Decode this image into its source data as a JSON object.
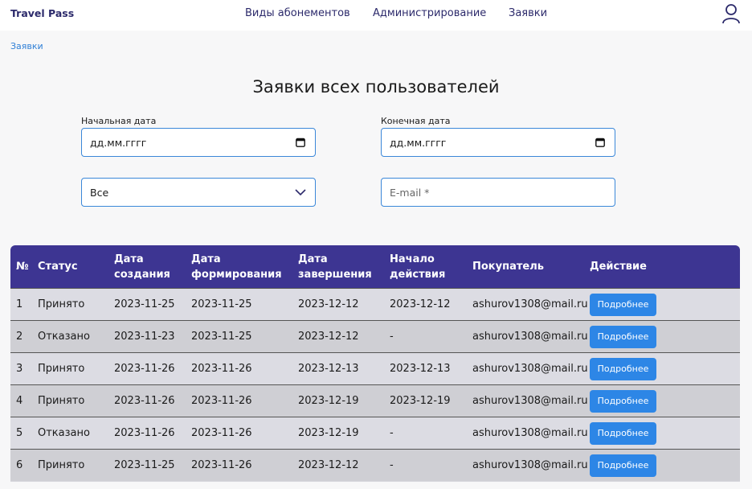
{
  "navbar": {
    "brand": "Travel Pass",
    "links": [
      "Виды абонементов",
      "Администрирование",
      "Заявки"
    ]
  },
  "breadcrumb": "Заявки",
  "page_title": "Заявки всех пользователей",
  "filters": {
    "start_date_label": "Начальная дата",
    "start_date_value": "дд.мм.гггг",
    "end_date_label": "Конечная дата",
    "end_date_value": "дд.мм.гггг",
    "status_select_value": "Все",
    "email_placeholder": "E-mail *"
  },
  "table": {
    "headers": {
      "num": "№",
      "status": "Статус",
      "created_1": "Дата",
      "created_2": "создания",
      "formed_1": "Дата",
      "formed_2": "формирования",
      "completed_1": "Дата",
      "completed_2": "завершения",
      "start_1": "Начало",
      "start_2": "действия",
      "buyer": "Покупатель",
      "action": "Действие"
    },
    "rows": [
      {
        "num": "1",
        "status": "Принято",
        "created": "2023-11-25",
        "formed": "2023-11-25",
        "completed": "2023-12-12",
        "start": "2023-12-12",
        "buyer": "ashurov1308@mail.ru",
        "action": "Подробнее"
      },
      {
        "num": "2",
        "status": "Отказано",
        "created": "2023-11-23",
        "formed": "2023-11-25",
        "completed": "2023-12-12",
        "start": "-",
        "buyer": "ashurov1308@mail.ru",
        "action": "Подробнее"
      },
      {
        "num": "3",
        "status": "Принято",
        "created": "2023-11-26",
        "formed": "2023-11-26",
        "completed": "2023-12-13",
        "start": "2023-12-13",
        "buyer": "ashurov1308@mail.ru",
        "action": "Подробнее"
      },
      {
        "num": "4",
        "status": "Принято",
        "created": "2023-11-26",
        "formed": "2023-11-26",
        "completed": "2023-12-19",
        "start": "2023-12-19",
        "buyer": "ashurov1308@mail.ru",
        "action": "Подробнее"
      },
      {
        "num": "5",
        "status": "Отказано",
        "created": "2023-11-26",
        "formed": "2023-11-26",
        "completed": "2023-12-19",
        "start": "-",
        "buyer": "ashurov1308@mail.ru",
        "action": "Подробнее"
      },
      {
        "num": "6",
        "status": "Принято",
        "created": "2023-11-25",
        "formed": "2023-11-26",
        "completed": "2023-12-12",
        "start": "-",
        "buyer": "ashurov1308@mail.ru",
        "action": "Подробнее"
      }
    ]
  },
  "colors": {
    "brand": "#2c2a6b",
    "table_header": "#3d3592",
    "button": "#2d86e6",
    "link": "#2f7fd6",
    "field_border": "#3b88d9"
  },
  "icons": [
    "user-icon",
    "calendar-icon",
    "chevron-down-icon"
  ]
}
